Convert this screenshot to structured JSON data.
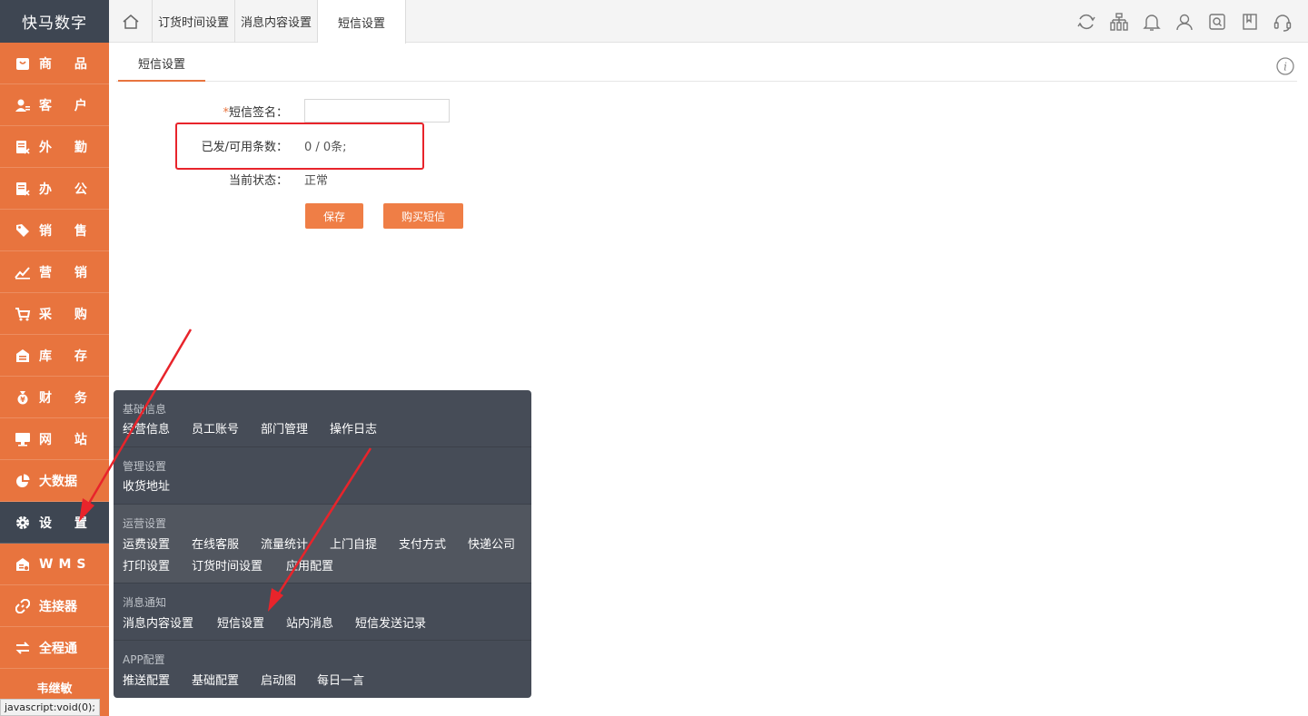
{
  "app": {
    "logo": "快马数字"
  },
  "sidebar": {
    "items": [
      {
        "label": "商 品",
        "icon": "bag-icon"
      },
      {
        "label": "客 户",
        "icon": "user-icon"
      },
      {
        "label": "外 勤",
        "icon": "field-icon"
      },
      {
        "label": "办 公",
        "icon": "office-icon"
      },
      {
        "label": "销 售",
        "icon": "tag-icon"
      },
      {
        "label": "营 销",
        "icon": "chart-icon"
      },
      {
        "label": "采 购",
        "icon": "cart-icon"
      },
      {
        "label": "库 存",
        "icon": "warehouse-icon"
      },
      {
        "label": "财 务",
        "icon": "money-bag-icon"
      },
      {
        "label": "网 站",
        "icon": "monitor-icon"
      },
      {
        "label": "大数据",
        "icon": "pie-icon"
      },
      {
        "label": "设 置",
        "icon": "gear-icon"
      },
      {
        "label": "WMS",
        "icon": "wms-icon"
      },
      {
        "label": "连接器",
        "icon": "link-icon"
      },
      {
        "label": "全程通",
        "icon": "swap-icon"
      }
    ],
    "user_name": "韦继敏"
  },
  "topbar": {
    "tabs": [
      "订货时间设置",
      "消息内容设置",
      "短信设置"
    ]
  },
  "content": {
    "subtab": "短信设置",
    "form": {
      "signature_label": "短信签名：",
      "signature_required_mark": "*",
      "signature_value": "",
      "count_label": "已发/可用条数：",
      "count_value": "0 / 0条;",
      "status_label": "当前状态：",
      "status_value": "正常",
      "save_button": "保存",
      "buy_button": "购买短信"
    }
  },
  "dropdown": {
    "sections": [
      {
        "title": "基础信息",
        "links": [
          "经营信息",
          "员工账号",
          "部门管理",
          "操作日志"
        ]
      },
      {
        "title": "管理设置",
        "links": [
          "收货地址"
        ]
      },
      {
        "title": "运营设置",
        "links": [
          "运费设置",
          "在线客服",
          "流量统计",
          "上门自提",
          "支付方式",
          "快递公司",
          "打印设置",
          "订货时间设置",
          "应用配置"
        ]
      },
      {
        "title": "消息通知",
        "links": [
          "消息内容设置",
          "短信设置",
          "站内消息",
          "短信发送记录"
        ]
      },
      {
        "title": "APP配置",
        "links": [
          "推送配置",
          "基础配置",
          "启动图",
          "每日一言"
        ]
      }
    ]
  },
  "status_bar": "javascript:void(0);",
  "colors": {
    "accent": "#e8743e",
    "dark": "#3e4652",
    "annotation": "#e8242b"
  }
}
